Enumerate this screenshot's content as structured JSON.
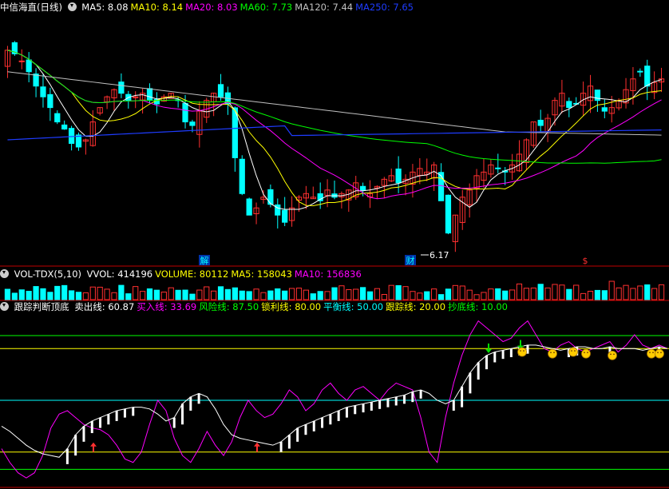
{
  "panels": {
    "price": {
      "title": "中信海直(日线)",
      "legend": [
        {
          "label": "MA5: 8.08",
          "color": "#ffffff"
        },
        {
          "label": "MA10: 8.14",
          "color": "#ffff00"
        },
        {
          "label": "MA20: 8.03",
          "color": "#ff00ff"
        },
        {
          "label": "MA60: 7.73",
          "color": "#00ff00"
        },
        {
          "label": "MA120: 7.44",
          "color": "#c0c0c0"
        },
        {
          "label": "MA250: 7.65",
          "color": "#1e3cff"
        }
      ],
      "markers": [
        {
          "label": "解",
          "color": "#00ffff",
          "bg": "#0033aa"
        },
        {
          "label": "财",
          "color": "#00ffff",
          "bg": "#0033aa"
        },
        {
          "label": "$",
          "color": "#ff3030",
          "bg": ""
        }
      ],
      "low_annotation": "6.17"
    },
    "volume": {
      "title": "VOL-TDX(5,10)",
      "legend": [
        {
          "label": "VVOL: 414196",
          "color": "#ffffff"
        },
        {
          "label": "VOLUME: 80112",
          "color": "#ffff00"
        },
        {
          "label": "MA5: 158043",
          "color": "#ffff00"
        },
        {
          "label": "MA10: 156836",
          "color": "#ff00ff"
        }
      ]
    },
    "indicator": {
      "title": "跟踪判断顶底",
      "legend": [
        {
          "label": "卖出线: 60.87",
          "color": "#ffffff"
        },
        {
          "label": "买入线: 33.69",
          "color": "#ff00ff"
        },
        {
          "label": "风险线: 87.50",
          "color": "#00ff00"
        },
        {
          "label": "锁利线: 80.00",
          "color": "#ffff00"
        },
        {
          "label": "平衡线: 50.00",
          "color": "#00ffff"
        },
        {
          "label": "跟踪线: 20.00",
          "color": "#ffff00"
        },
        {
          "label": "抄底线: 10.00",
          "color": "#00ff00"
        }
      ]
    }
  },
  "colors": {
    "up": "#ff3030",
    "down": "#00ffff",
    "panel_border": "#c00000",
    "bg": "#000000"
  },
  "chart_data": {
    "type": "candlestick",
    "price_ylim": [
      5.9,
      9.4
    ],
    "series_price_close": [
      8.9,
      8.85,
      8.75,
      8.6,
      8.4,
      8.25,
      8.1,
      7.9,
      7.8,
      7.6,
      7.55,
      7.65,
      7.9,
      8.1,
      8.25,
      8.35,
      8.3,
      8.2,
      8.25,
      8.3,
      8.2,
      8.15,
      8.25,
      8.3,
      8.2,
      7.9,
      7.85,
      8.05,
      8.2,
      8.3,
      8.25,
      8.15,
      7.4,
      6.9,
      6.6,
      6.7,
      6.85,
      6.75,
      6.6,
      6.5,
      6.7,
      6.85,
      6.9,
      6.85,
      6.8,
      6.95,
      6.85,
      6.9,
      6.95,
      7.05,
      6.95,
      6.9,
      7.0,
      7.1,
      7.15,
      7.05,
      7.1,
      7.2,
      7.25,
      7.2,
      7.3,
      6.8,
      6.35,
      6.6,
      6.85,
      6.95,
      7.15,
      7.2,
      7.3,
      7.25,
      7.2,
      7.3,
      7.45,
      7.65,
      7.9,
      7.85,
      7.95,
      8.2,
      8.3,
      8.1,
      8.15,
      8.3,
      8.4,
      8.2,
      8.05,
      8.1,
      8.2,
      8.35,
      8.5,
      8.6,
      8.4,
      8.45,
      8.5
    ],
    "volume_ylim": [
      0,
      600000
    ],
    "indicator_ylim": [
      0,
      100
    ],
    "reference_lines": [
      87.5,
      80,
      50,
      20,
      10
    ],
    "sell_line": [
      35,
      32,
      28,
      24,
      21,
      19,
      18,
      17,
      22,
      30,
      35,
      38,
      40,
      42,
      44,
      45,
      46,
      46,
      45,
      42,
      38,
      40,
      48,
      52,
      54,
      52,
      45,
      36,
      30,
      28,
      27,
      26,
      25,
      24,
      26,
      30,
      34,
      36,
      38,
      40,
      42,
      44,
      46,
      47,
      48,
      49,
      50,
      51,
      52,
      53,
      55,
      56,
      54,
      50,
      48,
      50,
      58,
      66,
      72,
      76,
      78,
      79,
      80,
      81,
      82,
      82,
      81,
      80,
      79,
      80,
      81,
      81,
      80,
      80,
      81,
      80,
      80,
      80,
      79,
      80,
      81,
      80
    ],
    "buy_line": [
      22,
      14,
      8,
      5,
      8,
      18,
      34,
      42,
      44,
      40,
      36,
      34,
      33,
      30,
      24,
      16,
      14,
      20,
      36,
      50,
      44,
      28,
      18,
      14,
      22,
      32,
      24,
      18,
      26,
      40,
      50,
      44,
      40,
      42,
      48,
      56,
      52,
      44,
      48,
      56,
      60,
      54,
      50,
      56,
      58,
      54,
      50,
      56,
      60,
      58,
      56,
      40,
      20,
      14,
      40,
      60,
      76,
      88,
      96,
      92,
      88,
      84,
      86,
      92,
      96,
      88,
      80,
      78,
      82,
      84,
      80,
      78,
      80,
      82,
      84,
      78,
      82,
      88,
      82,
      80,
      82,
      80
    ]
  }
}
